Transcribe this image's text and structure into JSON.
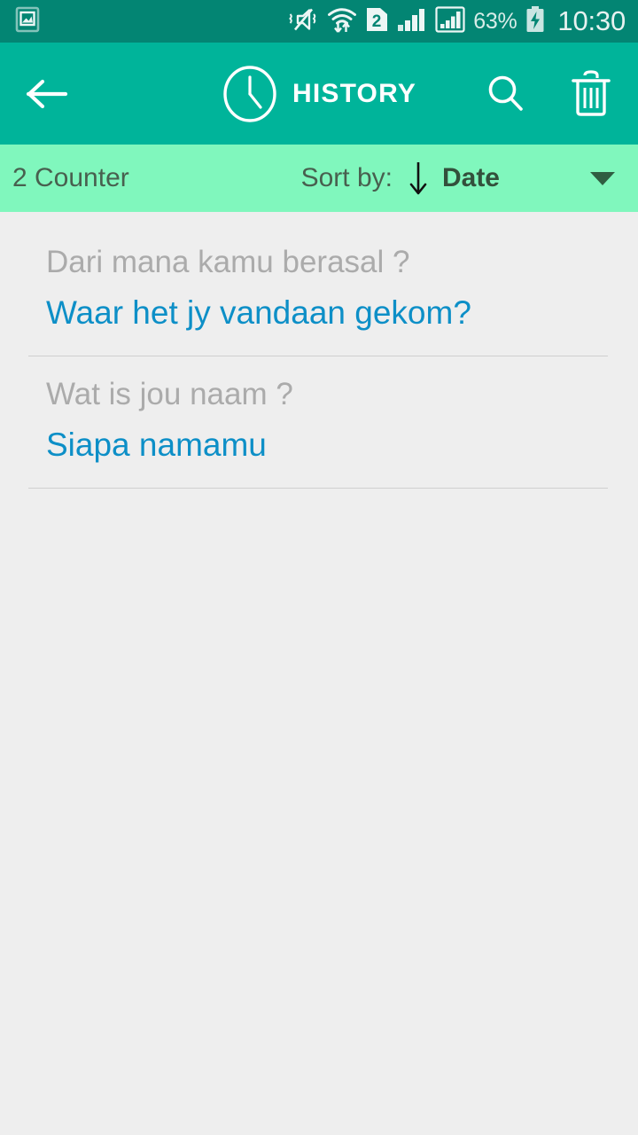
{
  "status_bar": {
    "background_color": "#038573",
    "left_icons": [
      {
        "name": "gallery-image-icon",
        "label": "image"
      }
    ],
    "right_icons": [
      {
        "name": "vibrate-mute-icon",
        "label": "sound off / vibrate"
      },
      {
        "name": "wifi-transfer-icon",
        "label": "wifi"
      },
      {
        "name": "sim-card-2-icon",
        "label": "2"
      },
      {
        "name": "signal-bars-icon",
        "label": "signal 1"
      },
      {
        "name": "signal-bars-boxed-icon",
        "label": "signal 2"
      }
    ],
    "battery_percent": "63%",
    "battery_charging": true,
    "clock": "10:30"
  },
  "app_bar": {
    "background_color": "#00b49a",
    "back_label": "Back",
    "clock_icon": "history-clock-icon",
    "title": "HISTORY",
    "search_label": "Search",
    "delete_label": "Delete all"
  },
  "sort_bar": {
    "background_color": "#80f7bd",
    "counter": "2 Counter",
    "sort_by_label": "Sort by:",
    "sort_direction": "descending",
    "sort_value": "Date",
    "dropdown_icon": "chevron-down-icon"
  },
  "history": {
    "items": [
      {
        "source": "Dari mana kamu berasal ?",
        "translation": "Waar het jy vandaan gekom?"
      },
      {
        "source": "Wat is jou naam ?",
        "translation": "Siapa namamu"
      }
    ]
  },
  "colors": {
    "accent_teal": "#00b49a",
    "status_teal": "#038573",
    "mint": "#80f7bd",
    "translation_blue": "#0d8fc7",
    "source_gray": "#ababab",
    "page_background": "#eeeeee"
  }
}
